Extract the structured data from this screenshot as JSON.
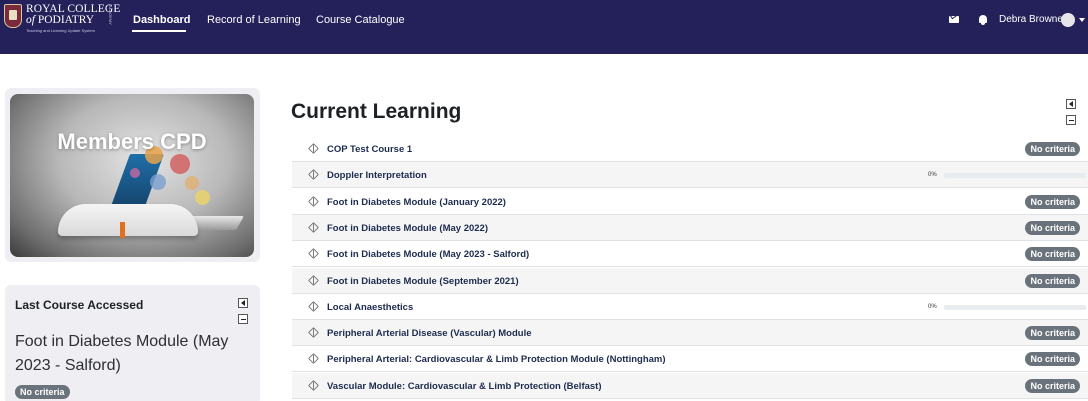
{
  "header": {
    "logo": {
      "line1": "ROYAL COLLEGE",
      "line2_prefix": "of",
      "line2": "PODIATRY",
      "tagline": "Teaching and Learning Update System",
      "academy": "ACADEMY"
    },
    "nav": [
      {
        "label": "Dashboard",
        "active": true
      },
      {
        "label": "Record of Learning",
        "active": false
      },
      {
        "label": "Course Catalogue",
        "active": false
      }
    ],
    "user_name": "Debra Browne",
    "icons": [
      "envelope-icon",
      "bell-icon",
      "avatar",
      "caret-down-icon"
    ]
  },
  "promo": {
    "title": "Members CPD"
  },
  "last_course": {
    "title": "Last Course Accessed",
    "course_name": "Foot in Diabetes Module (May 2023 - Salford)",
    "badge": "No criteria"
  },
  "main": {
    "title": "Current Learning",
    "courses": [
      {
        "name": "COP Test Course 1",
        "status": "badge",
        "badge": "No criteria"
      },
      {
        "name": "Doppler Interpretation",
        "status": "progress",
        "progress_label": "0%",
        "progress": 0
      },
      {
        "name": "Foot in Diabetes Module (January 2022)",
        "status": "badge",
        "badge": "No criteria"
      },
      {
        "name": "Foot in Diabetes Module (May 2022)",
        "status": "badge",
        "badge": "No criteria"
      },
      {
        "name": "Foot in Diabetes Module (May 2023 - Salford)",
        "status": "badge",
        "badge": "No criteria"
      },
      {
        "name": "Foot in Diabetes Module (September 2021)",
        "status": "badge",
        "badge": "No criteria"
      },
      {
        "name": "Local Anaesthetics",
        "status": "progress",
        "progress_label": "0%",
        "progress": 0
      },
      {
        "name": "Peripheral Arterial Disease (Vascular) Module",
        "status": "badge",
        "badge": "No criteria"
      },
      {
        "name": "Peripheral Arterial: Cardiovascular & Limb Protection Module (Nottingham)",
        "status": "badge",
        "badge": "No criteria"
      },
      {
        "name": "Vascular Module: Cardiovascular & Limb Protection (Belfast)",
        "status": "badge",
        "badge": "No criteria"
      }
    ]
  },
  "colors": {
    "navbar": "#23205a",
    "badge": "#6a737b",
    "card": "#eeeef3",
    "course_link": "#1d2b4f"
  }
}
